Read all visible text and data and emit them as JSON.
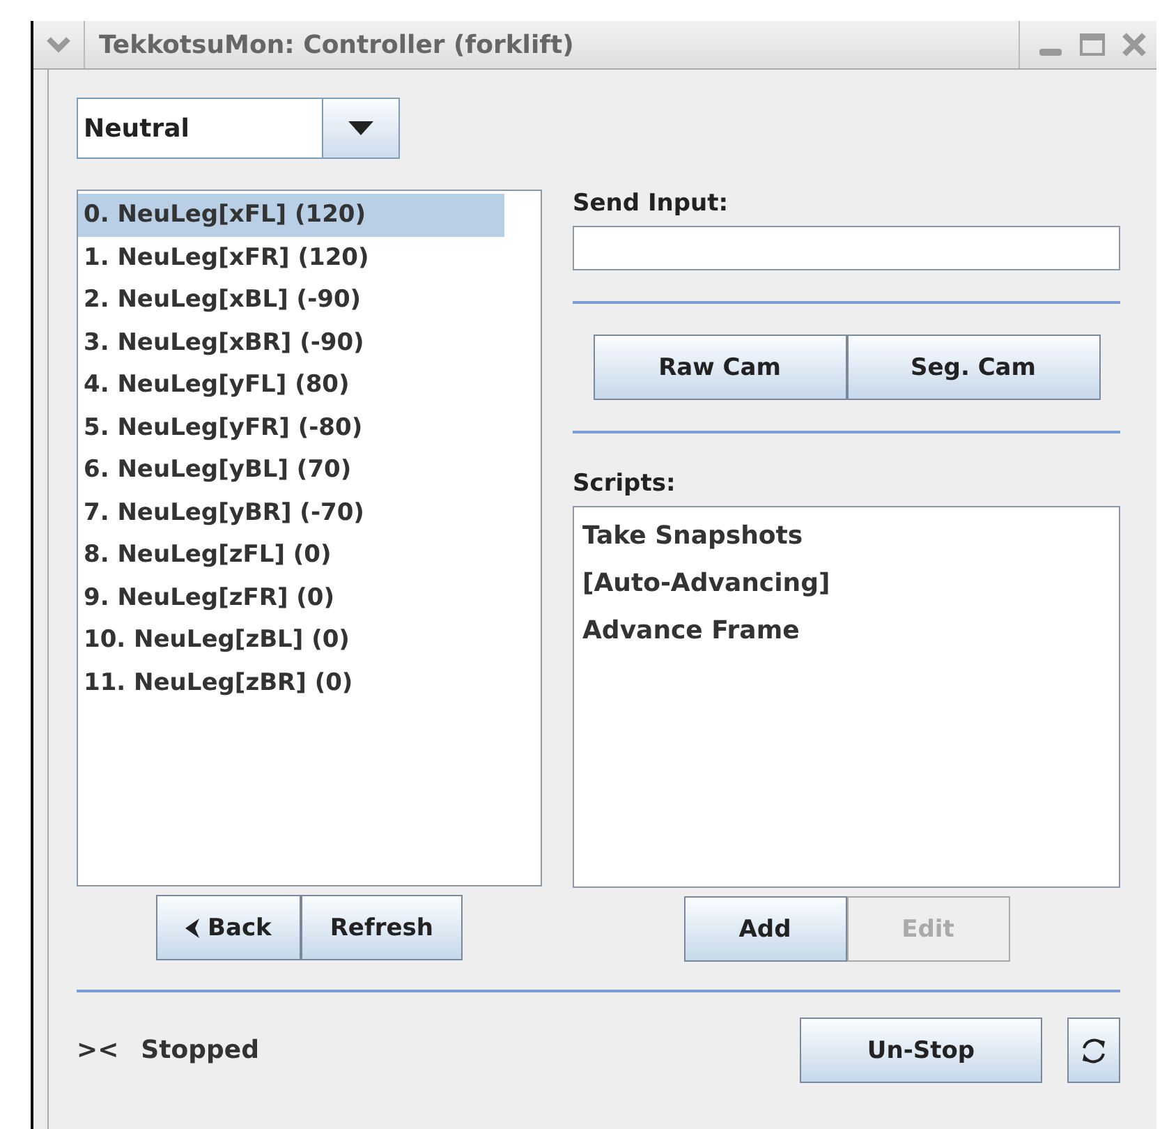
{
  "window": {
    "title": "TekkotsuMon: Controller (forklift)"
  },
  "preset_dropdown": {
    "value": "Neutral"
  },
  "outputs": [
    {
      "label": "0. NeuLeg[xFL] (120)",
      "selected": true
    },
    {
      "label": "1. NeuLeg[xFR] (120)",
      "selected": false
    },
    {
      "label": "2. NeuLeg[xBL] (-90)",
      "selected": false
    },
    {
      "label": "3. NeuLeg[xBR] (-90)",
      "selected": false
    },
    {
      "label": "4. NeuLeg[yFL] (80)",
      "selected": false
    },
    {
      "label": "5. NeuLeg[yFR] (-80)",
      "selected": false
    },
    {
      "label": "6. NeuLeg[yBL] (70)",
      "selected": false
    },
    {
      "label": "7. NeuLeg[yBR] (-70)",
      "selected": false
    },
    {
      "label": "8. NeuLeg[zFL] (0)",
      "selected": false
    },
    {
      "label": "9. NeuLeg[zFR] (0)",
      "selected": false
    },
    {
      "label": "10. NeuLeg[zBL] (0)",
      "selected": false
    },
    {
      "label": "11. NeuLeg[zBR] (0)",
      "selected": false
    }
  ],
  "output_buttons": [
    {
      "label": "Back",
      "kind": "back"
    },
    {
      "label": "Refresh",
      "kind": "plain"
    }
  ],
  "send_input": {
    "label": "Send Input:"
  },
  "camera_buttons": [
    "Raw Cam",
    "Seg. Cam"
  ],
  "scripts": {
    "label": "Scripts:",
    "items": [
      {
        "label": "Take Snapshots",
        "selected": false
      },
      {
        "label": "[Auto-Advancing]",
        "selected": false
      },
      {
        "label": "Advance Frame",
        "selected": false
      }
    ]
  },
  "script_buttons": [
    {
      "label": "Add",
      "disabled": false
    },
    {
      "label": "Edit",
      "disabled": true
    }
  ],
  "status": {
    "icon_text": "><",
    "text": "Stopped"
  },
  "unstop_button": "Un-Stop"
}
